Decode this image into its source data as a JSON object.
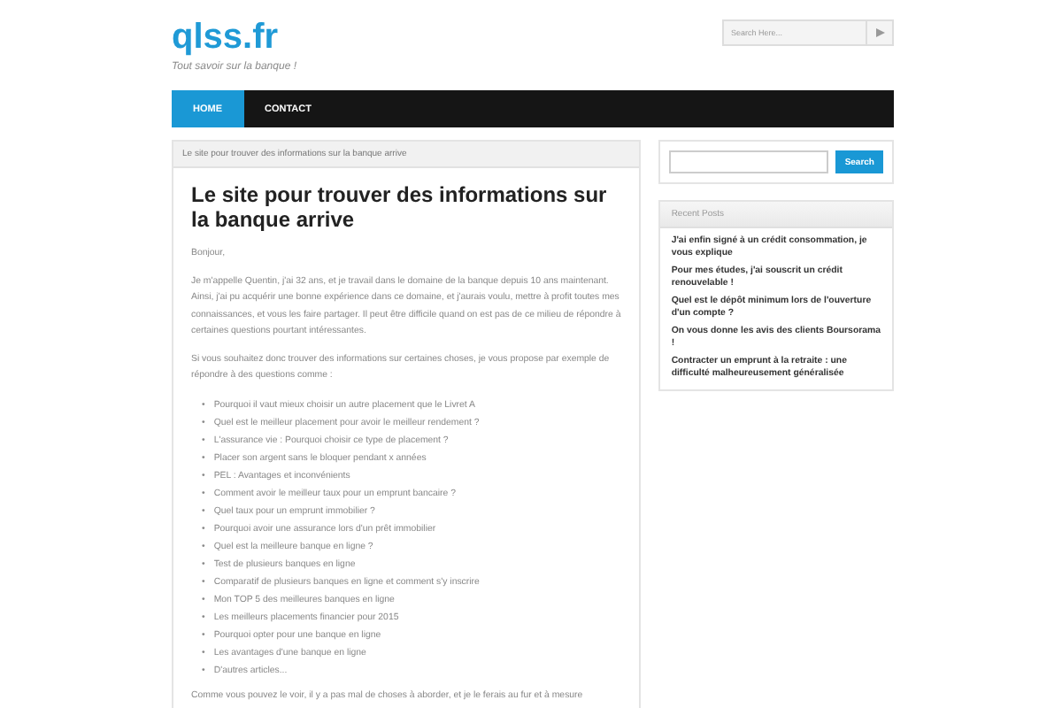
{
  "header": {
    "site_title": "qlss.fr",
    "tagline": "Tout savoir sur la banque !",
    "search": {
      "placeholder": "Search Here..."
    }
  },
  "nav": [
    {
      "label": "HOME",
      "selected": true
    },
    {
      "label": "CONTACT",
      "selected": false
    }
  ],
  "breadcrumb": "Le site pour trouver des informations sur la banque arrive",
  "post": {
    "title": "Le site pour trouver des informations sur la banque arrive",
    "paragraphs": [
      "Bonjour,",
      "Je m'appelle Quentin, j'ai 32 ans,  et je travail dans le domaine de la banque depuis 10 ans maintenant. Ainsi, j'ai pu acquérir une bonne expérience dans ce domaine, et j'aurais voulu, mettre à profit toutes mes connaissances, et vous les faire partager. Il peut être difficile quand on est pas de ce milieu de répondre à certaines questions pourtant intéressantes.",
      "Si vous souhaitez donc trouver des informations sur certaines choses, je vous propose par exemple de répondre à des questions comme :"
    ],
    "bullet": "•",
    "list": [
      "Pourquoi il vaut mieux choisir un autre placement que le Livret A",
      "Quel est le meilleur placement pour avoir le meilleur rendement ?",
      "L'assurance vie : Pourquoi choisir ce type de placement ?",
      "Placer son argent sans le bloquer pendant x années",
      "PEL : Avantages et inconvénients",
      "Comment avoir le meilleur taux pour un emprunt bancaire ?",
      "Quel taux pour un emprunt immobilier ?",
      "Pourquoi avoir une assurance lors d'un prêt immobilier",
      "Quel est la meilleure banque en ligne ?",
      "Test de plusieurs banques en ligne",
      "Comparatif de plusieurs banques en ligne et comment s'y inscrire",
      "Mon TOP 5 des meilleures banques en ligne",
      "Les meilleurs placements financier pour 2015",
      "Pourquoi opter pour une banque en ligne",
      "Les avantages d'une banque en ligne",
      "D'autres articles..."
    ],
    "closing": "Comme vous pouvez le voir, il y a pas mal de choses à aborder, et je le ferais au fur et à mesure"
  },
  "sidebar": {
    "search_button": "Search",
    "recent_posts_title": "Recent Posts",
    "recent_posts": [
      "J'ai enfin signé à un crédit consommation, je vous explique",
      "Pour mes études, j'ai souscrit un crédit renouvelable !",
      "Quel est le dépôt minimum lors de l'ouverture d'un compte ?",
      "On vous donne les avis des clients Boursorama !",
      "Contracter un emprunt à la retraite : une difficulté malheureusement généralisée"
    ]
  }
}
